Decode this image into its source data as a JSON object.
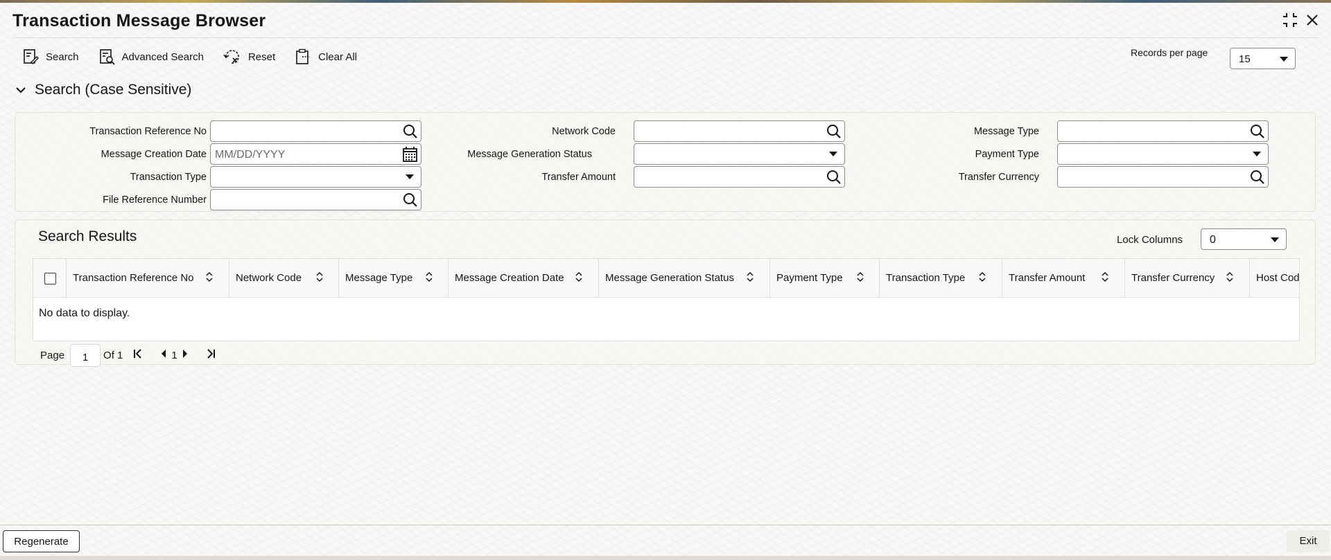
{
  "window": {
    "title": "Transaction Message Browser",
    "icons": [
      "collapse-icon",
      "close-icon"
    ]
  },
  "toolbar": {
    "search_label": "Search",
    "advanced_search_label": "Advanced Search",
    "reset_label": "Reset",
    "clear_all_label": "Clear All",
    "records_per_page_label": "Records per page",
    "records_per_page_value": "15"
  },
  "search_section": {
    "title": "Search (Case Sensitive)",
    "fields": {
      "transaction_reference_no": {
        "label": "Transaction Reference No",
        "value": ""
      },
      "message_creation_date": {
        "label": "Message Creation Date",
        "placeholder": "MM/DD/YYYY"
      },
      "transaction_type": {
        "label": "Transaction Type",
        "value": ""
      },
      "file_reference_number": {
        "label": "File Reference Number",
        "value": ""
      },
      "network_code": {
        "label": "Network Code",
        "value": ""
      },
      "message_generation_status": {
        "label": "Message Generation Status",
        "value": ""
      },
      "transfer_amount": {
        "label": "Transfer Amount",
        "value": ""
      },
      "message_type": {
        "label": "Message Type",
        "value": ""
      },
      "payment_type": {
        "label": "Payment Type",
        "value": ""
      },
      "transfer_currency": {
        "label": "Transfer Currency",
        "value": ""
      }
    }
  },
  "results": {
    "title": "Search Results",
    "lock_columns_label": "Lock Columns",
    "lock_columns_value": "0",
    "columns": [
      "Transaction Reference No",
      "Network Code",
      "Message Type",
      "Message Creation Date",
      "Message Generation Status",
      "Payment Type",
      "Transaction Type",
      "Transfer Amount",
      "Transfer Currency",
      "Host Cod"
    ],
    "empty_message": "No data to display.",
    "pagination": {
      "page_label": "Page",
      "page_value": "1",
      "of_label": "Of 1",
      "current_page": "1"
    }
  },
  "footer": {
    "regenerate_label": "Regenerate",
    "exit_label": "Exit"
  },
  "colors": {
    "text": "#161513",
    "border": "#8f8b86",
    "background": "#f9f8f6"
  }
}
